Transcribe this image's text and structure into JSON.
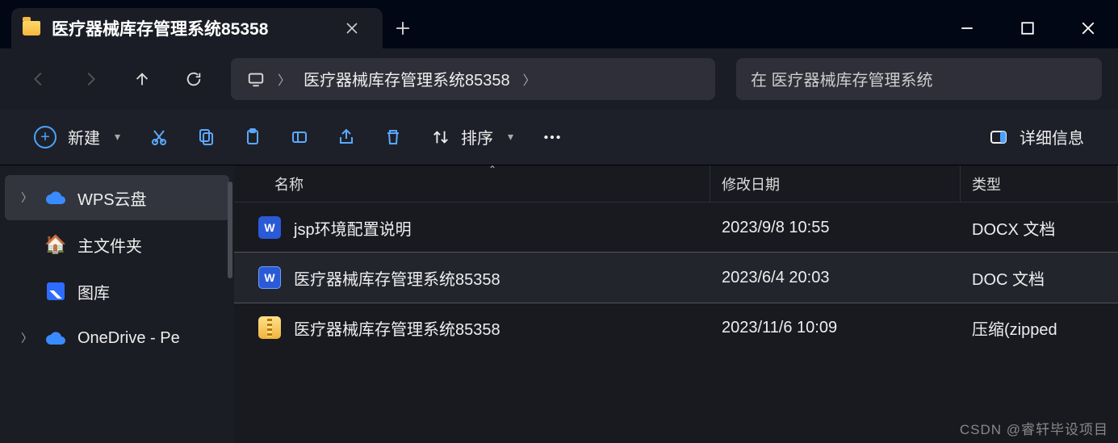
{
  "window": {
    "tab_title": "医疗器械库存管理系统85358"
  },
  "nav": {
    "breadcrumb_current": "医疗器械库存管理系统85358",
    "search_placeholder": "在 医疗器械库存管理系统"
  },
  "toolbar": {
    "new_label": "新建",
    "sort_label": "排序",
    "view_label": "详细信息"
  },
  "sidebar": {
    "items": [
      {
        "label": "WPS云盘",
        "expandable": true
      },
      {
        "label": "主文件夹",
        "expandable": false
      },
      {
        "label": "图库",
        "expandable": false
      },
      {
        "label": "OneDrive - Pe",
        "expandable": true
      }
    ]
  },
  "columns": {
    "name": "名称",
    "modified": "修改日期",
    "type": "类型"
  },
  "files": [
    {
      "name": "jsp环境配置说明",
      "modified": "2023/9/8 10:55",
      "type": "DOCX 文档",
      "icon": "docx"
    },
    {
      "name": "医疗器械库存管理系统85358",
      "modified": "2023/6/4 20:03",
      "type": "DOC 文档",
      "icon": "doc"
    },
    {
      "name": "医疗器械库存管理系统85358",
      "modified": "2023/11/6 10:09",
      "type": "压缩(zipped",
      "icon": "zip"
    }
  ],
  "watermark": "CSDN @睿轩毕设项目"
}
